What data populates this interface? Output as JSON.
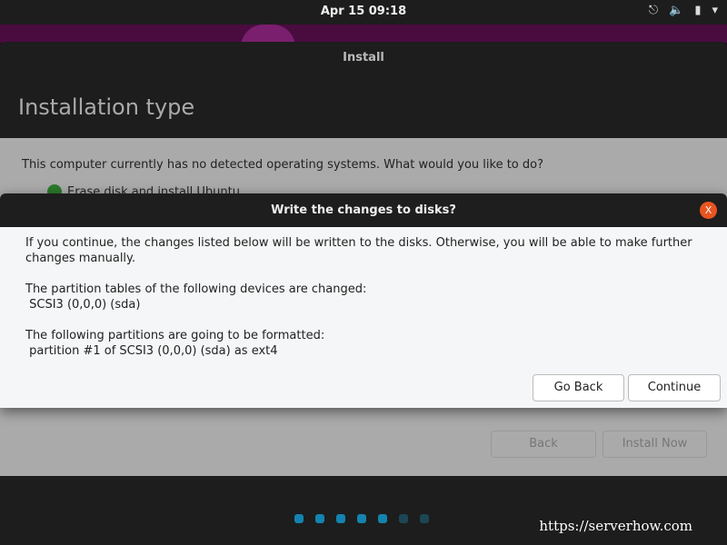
{
  "topbar": {
    "clock": "Apr 15  09:18",
    "icons": [
      "network-icon",
      "volume-icon",
      "battery-icon",
      "menu-arrow-icon"
    ]
  },
  "window": {
    "title": "Install",
    "heading": "Installation type",
    "question": "This computer currently has no detected operating systems. What would you like to do?",
    "option": "Erase disk and install Ubuntu",
    "back": "Back",
    "install_now": "Install Now"
  },
  "progress": {
    "total": 7,
    "completed": 5
  },
  "dialog": {
    "title": "Write the changes to disks?",
    "close": "X",
    "p1": "If you continue, the changes listed below will be written to the disks. Otherwise, you will be able to make further changes manually.",
    "p2a": "The partition tables of the following devices are changed:",
    "p2b": " SCSI3 (0,0,0) (sda)",
    "p3a": "The following partitions are going to be formatted:",
    "p3b": " partition #1 of SCSI3 (0,0,0) (sda) as ext4",
    "go_back": "Go Back",
    "continue": "Continue"
  },
  "watermark": "https://serverhow.com"
}
